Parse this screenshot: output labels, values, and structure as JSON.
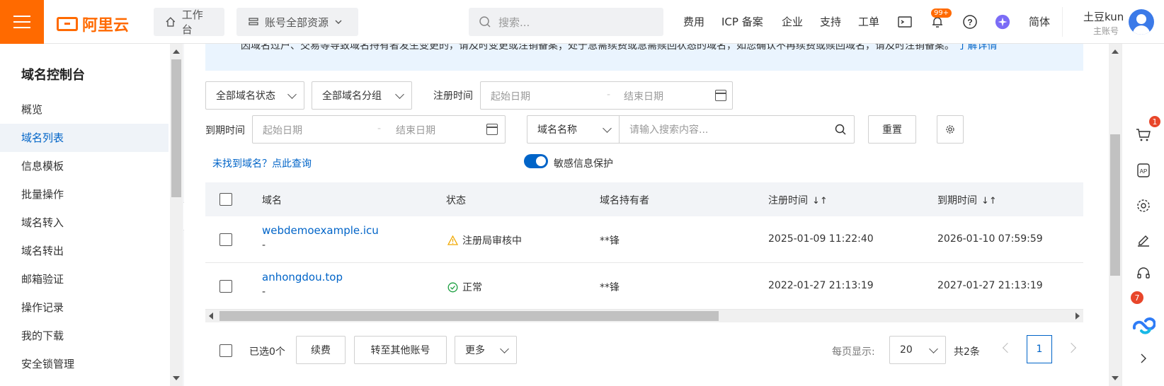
{
  "header": {
    "logo_text": "阿里云",
    "workbench": "工作台",
    "resources": "账号全部资源",
    "search_placeholder": "搜索...",
    "nav": [
      "费用",
      "ICP 备案",
      "企业",
      "支持",
      "工单"
    ],
    "notification_badge": "99+",
    "language": "简体",
    "user_name": "土豆kun",
    "user_role": "主账号",
    "brand_color": "#ff6a00"
  },
  "sidebar": {
    "title": "域名控制台",
    "items": [
      "概览",
      "域名列表",
      "信息模板",
      "批量操作",
      "域名转入",
      "域名转出",
      "邮箱验证",
      "操作记录",
      "我的下载",
      "安全锁管理"
    ],
    "active_index": 1
  },
  "notice": {
    "text": "因域名过户、交易等导致域名持有者发生变更的，请及时变更或注销备案；处于急需续费或急需赎回状态的域名，如您确认不再续费或赎回域名，请及时注销备案。",
    "link": "了解详情"
  },
  "filters": {
    "status": "全部域名状态",
    "group": "全部域名分组",
    "reg_time_label": "注册时间",
    "exp_time_label": "到期时间",
    "start_date": "起始日期",
    "end_date": "结束日期",
    "separator": "-",
    "search_field": "域名名称",
    "search_placeholder": "请输入搜索内容...",
    "reset": "重置",
    "not_found_link": "未找到域名？点此查询",
    "privacy_label": "敏感信息保护",
    "privacy_on": true
  },
  "table": {
    "headers": [
      "域名",
      "状态",
      "域名持有者",
      "注册时间",
      "到期时间"
    ],
    "rows": [
      {
        "domain": "webdemoexample.icu",
        "sub": "-",
        "status": "注册局审核中",
        "status_icon": "warning-icon",
        "owner": "**锋",
        "reg_time": "2025-01-09 11:22:40",
        "exp_time": "2026-01-10 07:59:59"
      },
      {
        "domain": "anhongdou.top",
        "sub": "-",
        "status": "正常",
        "status_icon": "check-circle-icon",
        "owner": "**锋",
        "reg_time": "2022-01-27 21:13:19",
        "exp_time": "2027-01-27 21:13:19"
      }
    ]
  },
  "footer": {
    "selected": "已选0个",
    "renew": "续费",
    "transfer": "转至其他账号",
    "more": "更多",
    "per_page_label": "每页显示:",
    "per_page": "20",
    "total": "共2条",
    "current_page": "1"
  },
  "rail": {
    "cart_badge": "1",
    "assistant_badge": "7"
  }
}
